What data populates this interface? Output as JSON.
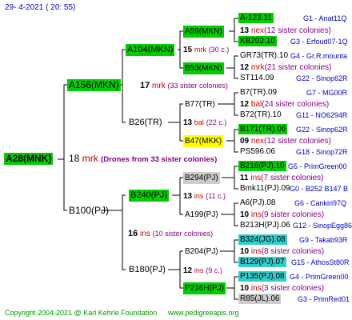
{
  "header": {
    "date": "29-  4-2021  (  20: 55)"
  },
  "footer": {
    "copyright": "Copyright 2004-2021 @ Karl Kehrle Foundation",
    "site": "www.pedigreeapis.org"
  },
  "root": {
    "name": "A28(MNK)",
    "count": "18",
    "unit": "mrk",
    "note": "(Drones from 33 sister colonies)"
  },
  "gen1": [
    {
      "name": "A156(MKN)",
      "count": "17",
      "unit": "mrk",
      "note": "(33 sister colonies)"
    },
    {
      "name": "B100(PJ)",
      "count": "16",
      "unit": "ins",
      "note": "(10 sister colonies)"
    }
  ],
  "gen2": [
    {
      "name": "A104(MKN)",
      "count": "15",
      "unit": "mrk",
      "note": "(30 c.)"
    },
    {
      "name": "B26(TR)",
      "count": "13",
      "unit": "bal",
      "note": "(22 c.)"
    },
    {
      "name": "B240(PJ)",
      "count": "13",
      "unit": "ins",
      "note": "(11 c.)"
    },
    {
      "name": "B180(PJ)",
      "count": "12",
      "unit": "ins",
      "note": "(9 c.)"
    }
  ],
  "gen3": [
    {
      "name": "A59(MKN)",
      "count": "13",
      "unit": "nex",
      "note": "(12 sister colonies)"
    },
    {
      "name": "B53(MKN)",
      "count": "12",
      "unit": "mrk",
      "note": "(21 sister colonies)"
    },
    {
      "name": "B77(TR)",
      "count": "12",
      "unit": "bal",
      "note": "(24 sister colonies)"
    },
    {
      "name": "B47(MKK)",
      "count": "09",
      "unit": "nex",
      "note": "(12 sister colonies)"
    },
    {
      "name": "B294(PJ)",
      "count": "11",
      "unit": "ins",
      "note": "(7 sister colonies)"
    },
    {
      "name": "A199(PJ)",
      "count": "10",
      "unit": "ins",
      "note": "(9 sister colonies)"
    },
    {
      "name": "B204(PJ)",
      "count": "10",
      "unit": "ins",
      "note": "(8 sister colonies)"
    },
    {
      "name": "P216H(PJ)",
      "count": "10",
      "unit": "ins",
      "note": "(3 sister colonies)"
    }
  ],
  "gen4": [
    {
      "name": "A-123.11",
      "info": "G1 - Anat11Q"
    },
    {
      "name": "KB202.10",
      "info": "G3 - Erfoud07-1Q"
    },
    {
      "name": "GR73(TR).10",
      "info": "G4 - Gr.R.mounta"
    },
    {
      "name": "ST114.09",
      "info": "G22 - Sinop62R"
    },
    {
      "name": "B7(TR).09",
      "info": "G7 - MG00R"
    },
    {
      "name": "B72(TR).10",
      "info": "G11 - NO6294R"
    },
    {
      "name": "B171(TR).06",
      "info": "G22 - Sinop62R"
    },
    {
      "name": "PS596.06",
      "info": "G18 - Sinop72R"
    },
    {
      "name": "B216(PJ).10",
      "info": "G5 - PrimGreen00"
    },
    {
      "name": "Bmk11(PJ).09",
      "info": "G0 - B252 B147 B"
    },
    {
      "name": "A6(PJ).08",
      "info": "G6 - Cankiri97Q"
    },
    {
      "name": "B213H(PJ).06",
      "info": "G12 - SinopEgg86R"
    },
    {
      "name": "B324(JG).08",
      "info": "G9 - Takab93R"
    },
    {
      "name": "B129(PJ).07",
      "info": "G15 - AthosSt80R"
    },
    {
      "name": "P135(PJ).08",
      "info": "G4 - PrimGreen00"
    },
    {
      "name": "R85(JL).06",
      "info": "G3 - PrimRed01"
    }
  ],
  "colors": {
    "green": "#00cc00",
    "yellow": "#ffff00",
    "gray": "#cccccc",
    "cyan": "#33cccc",
    "blue": "#0000cc",
    "red": "#cc0000",
    "purple": "#880088"
  }
}
